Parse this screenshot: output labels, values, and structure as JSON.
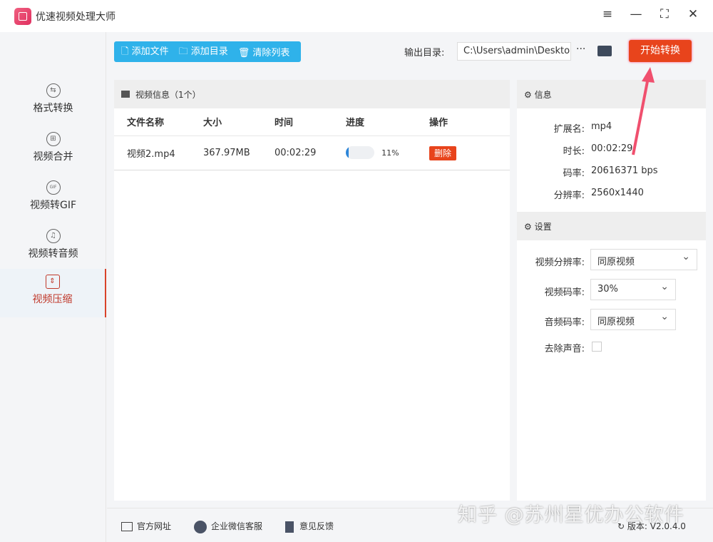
{
  "app": {
    "title": "优速视频处理大师"
  },
  "window": {
    "menu": "≡",
    "minimize": "—",
    "maximize": "⛶",
    "close": "✕"
  },
  "sidebar": {
    "items": [
      {
        "label": "格式转换",
        "icon": "⇆"
      },
      {
        "label": "视频合并",
        "icon": "⊞"
      },
      {
        "label": "视频转GIF",
        "icon": "GIF"
      },
      {
        "label": "视频转音频",
        "icon": "♫"
      },
      {
        "label": "视频压缩",
        "icon": "⇕"
      }
    ]
  },
  "toolbar": {
    "add_file": "🗋 添加文件",
    "add_dir": "🗀 添加目录",
    "clear": "🗑 清除列表",
    "output_label": "输出目录:",
    "output_path": "C:\\Users\\admin\\Desktop",
    "more": "···",
    "start": "开始转换"
  },
  "list": {
    "title": "视频信息（1个）",
    "columns": [
      "文件名称",
      "大小",
      "时间",
      "进度",
      "操作"
    ],
    "rows": [
      {
        "name": "视频2.mp4",
        "size": "367.97MB",
        "time": "00:02:29",
        "progress_pct": 11,
        "progress_label": "11%",
        "action": "删除"
      }
    ]
  },
  "info": {
    "title": "信息",
    "rows": [
      {
        "k": "扩展名:",
        "v": "mp4"
      },
      {
        "k": "时长:",
        "v": "00:02:29"
      },
      {
        "k": "码率:",
        "v": "20616371 bps"
      },
      {
        "k": "分辨率:",
        "v": "2560x1440"
      }
    ]
  },
  "settings": {
    "title": "设置",
    "resolution_label": "视频分辨率:",
    "resolution": "同原视频",
    "bitrate_label": "视频码率:",
    "bitrate": "30%",
    "audio_label": "音频码率:",
    "audio": "同原视频",
    "mute_label": "去除声音:",
    "mute": false
  },
  "footer": {
    "site": "官方网址",
    "wechat": "企业微信客服",
    "feedback": "意见反馈",
    "version": "版本: V2.0.4.0"
  },
  "watermark": "知乎 @苏州星优办公软件"
}
